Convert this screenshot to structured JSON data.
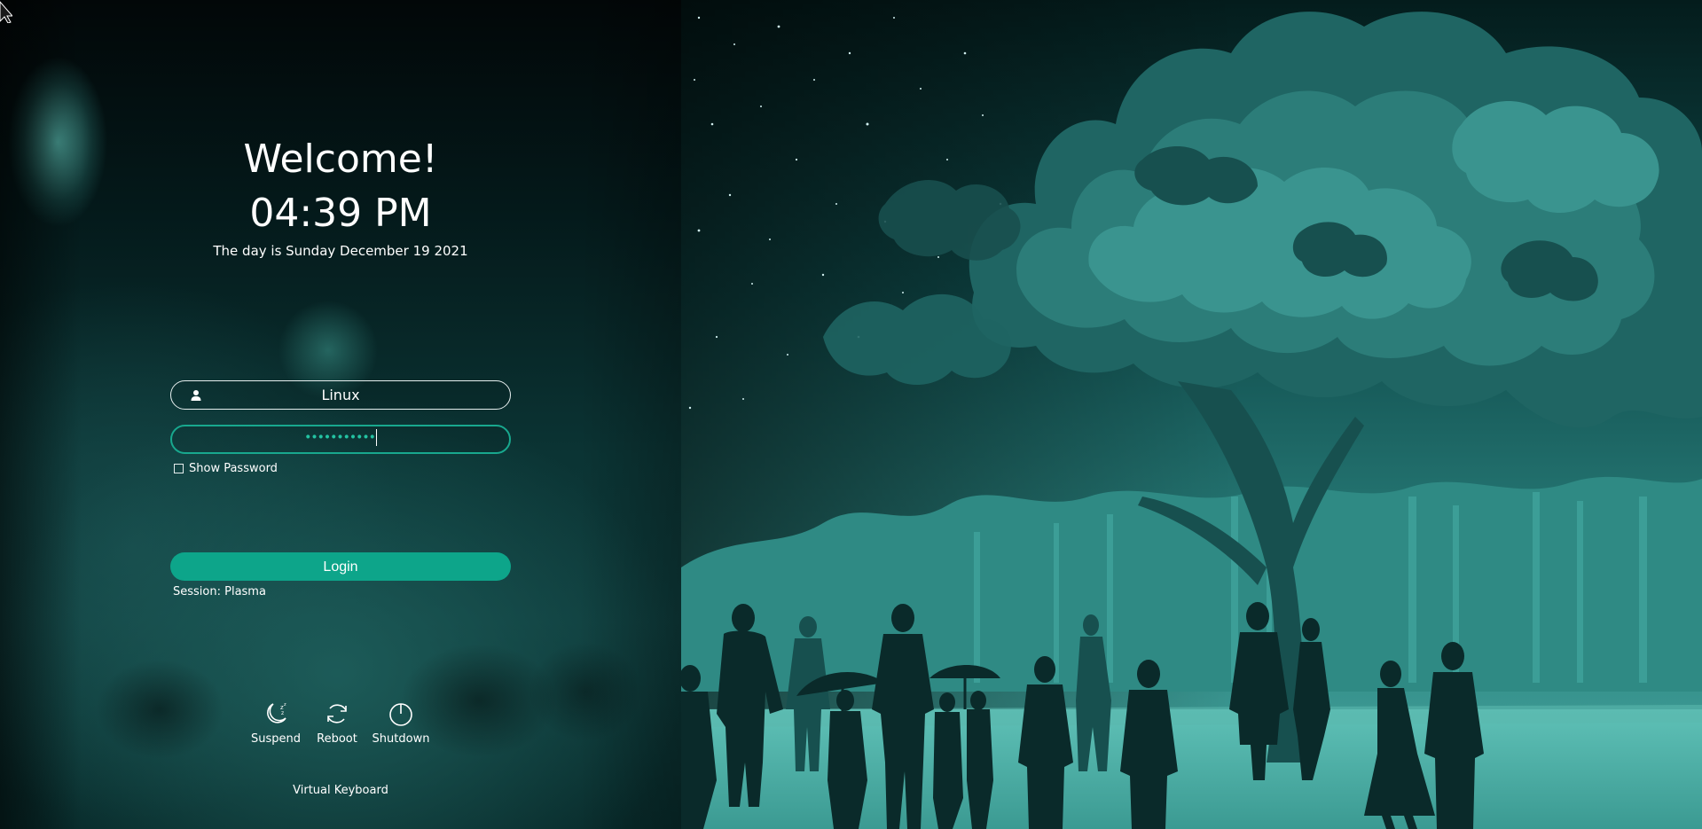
{
  "greeting": "Welcome!",
  "time": "04:39 PM",
  "date_text": "The day is Sunday December 19 2021",
  "login_form": {
    "username": "Linux",
    "password_mask": "•••••••••••",
    "show_password_label": "Show Password",
    "show_password_checked": false,
    "login_label": "Login",
    "session_text": "Session: Plasma"
  },
  "power_actions": [
    {
      "label": "Suspend",
      "icon": "moon-sleep-icon"
    },
    {
      "label": "Reboot",
      "icon": "reboot-icon"
    },
    {
      "label": "Shutdown",
      "icon": "power-icon"
    }
  ],
  "virtual_keyboard_label": "Virtual Keyboard",
  "colors": {
    "accent": "#0da58a",
    "focus_border": "#18a88e",
    "text": "#ffffff",
    "panel_dark": "#04191a",
    "illustration_teal": "#2f8a84"
  }
}
